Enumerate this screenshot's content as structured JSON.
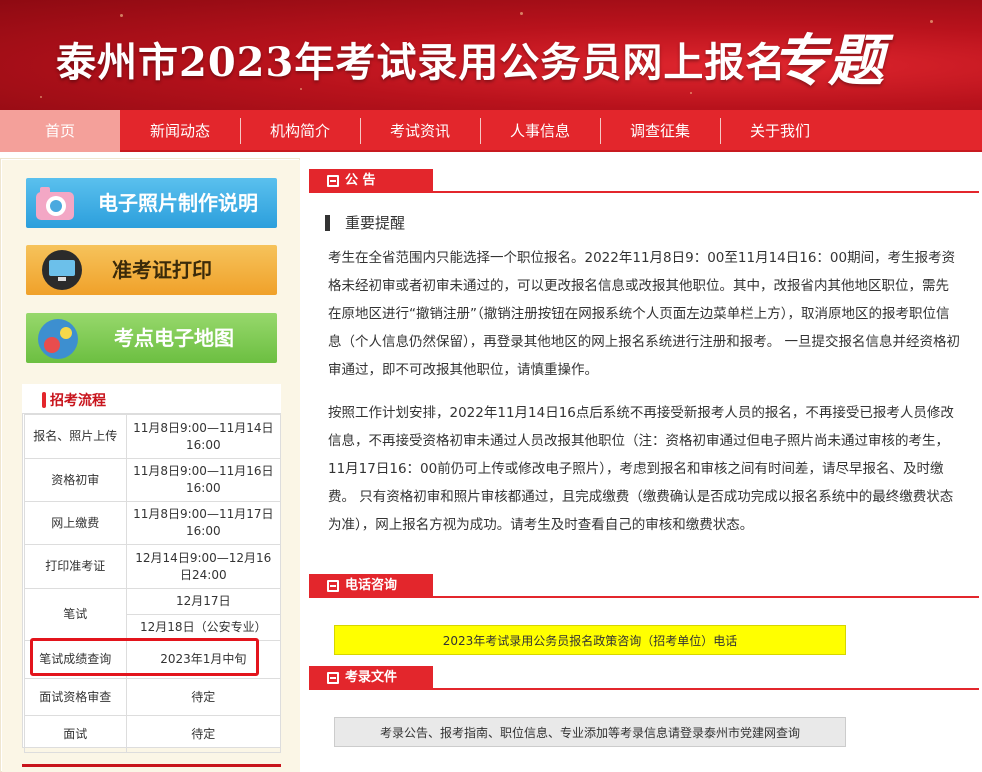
{
  "banner": {
    "title": "泰州市2023年考试录用公务员网上报名",
    "title_accent": "专题"
  },
  "nav": [
    "首页",
    "新闻动态",
    "机构简介",
    "考试资讯",
    "人事信息",
    "调查征集",
    "关于我们"
  ],
  "left_buttons": [
    "电子照片制作说明",
    "准考证打印",
    "考点电子地图"
  ],
  "process": {
    "title": "招考流程",
    "rows": [
      {
        "step": "报名、照片上传",
        "time": "11月8日9:00—11月14日16:00"
      },
      {
        "step": "资格初审",
        "time": "11月8日9:00—11月16日16:00"
      },
      {
        "step": "网上缴费",
        "time": "11月8日9:00—11月17日16:00"
      },
      {
        "step": "打印准考证",
        "time": "12月14日9:00—12月16日24:00"
      },
      {
        "step": "笔试",
        "time": "12月17日",
        "time2": "12月18日（公安专业）"
      },
      {
        "step": "笔试成绩查询",
        "time": "2023年1月中旬"
      },
      {
        "step": "面试资格审查",
        "time": "待定"
      },
      {
        "step": "面试",
        "time": "待定"
      }
    ]
  },
  "sections": {
    "notice": "公 告",
    "phone": "电话咨询",
    "docs": "考录文件"
  },
  "notice": {
    "heading": "重要提醒",
    "p1": "考生在全省范围内只能选择一个职位报名。2022年11月8日9：00至11月14日16：00期间，考生报考资格未经初审或者初审未通过的，可以更改报名信息或改报其他职位。其中，改报省内其他地区职位，需先在原地区进行“撤销注册”（撤销注册按钮在网报系统个人页面左边菜单栏上方），取消原地区的报考职位信息（个人信息仍然保留），再登录其他地区的网上报名系统进行注册和报考。 一旦提交报名信息并经资格初审通过，即不可改报其他职位，请慎重操作。",
    "p2": "按照工作计划安排，2022年11月14日16点后系统不再接受新报考人员的报名，不再接受已报考人员修改信息，不再接受资格初审未通过人员改报其他职位（注：资格初审通过但电子照片尚未通过审核的考生，11月17日16：00前仍可上传或修改电子照片），考虑到报名和审核之间有时间差，请尽早报名、及时缴费。 只有资格初审和照片审核都通过，且完成缴费（缴费确认是否成功完成以报名系统中的最终缴费状态为准），网上报名方视为成功。请考生及时查看自己的审核和缴费状态。"
  },
  "phone_link": "2023年考试录用公务员报名政策咨询（招考单位）电话",
  "docs_link": "考录公告、报考指南、职位信息、专业添加等考录信息请登录泰州市党建网查询",
  "colors": {
    "brand_red": "#e3262c",
    "highlight": "#ffff00"
  }
}
